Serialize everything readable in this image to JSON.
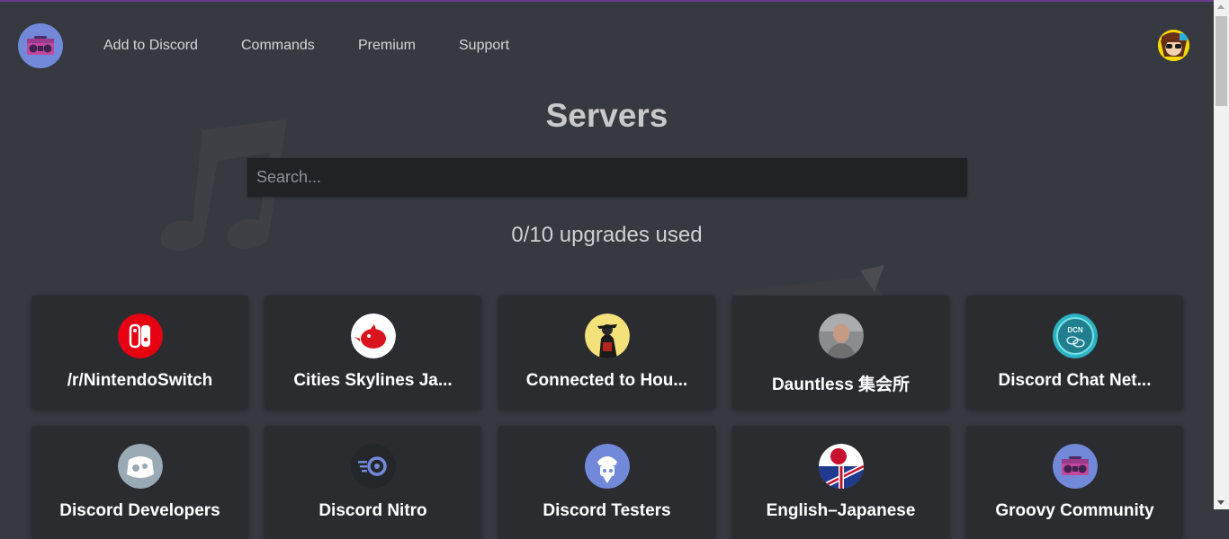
{
  "nav": {
    "logo": "boombox-logo",
    "links": [
      "Add to Discord",
      "Commands",
      "Premium",
      "Support"
    ],
    "user_avatar": "user-avatar"
  },
  "page": {
    "title": "Servers",
    "search_placeholder": "Search...",
    "upgrades_text": "0/10 upgrades used"
  },
  "servers": [
    {
      "name": "/r/NintendoSwitch",
      "icon": "nintendo-switch-icon",
      "color": "#e60012"
    },
    {
      "name": "Cities Skylines Ja...",
      "icon": "red-bird-icon",
      "color": "#ffffff"
    },
    {
      "name": "Connected to Hou...",
      "icon": "samurai-icon",
      "color": "#f5e17a"
    },
    {
      "name": "Dauntless 集会所",
      "icon": "person-photo-icon",
      "color": "#8a8d90"
    },
    {
      "name": "Discord Chat Net...",
      "icon": "dcn-icon",
      "color": "#2bb3c0"
    },
    {
      "name": "Discord Developers",
      "icon": "discord-gears-icon",
      "color": "#99aab5"
    },
    {
      "name": "Discord Nitro",
      "icon": "nitro-icon",
      "color": "#23272a"
    },
    {
      "name": "Discord Testers",
      "icon": "discord-tester-icon",
      "color": "#7289da"
    },
    {
      "name": "English–Japanese",
      "icon": "uk-japan-flag-icon",
      "color": "#ffffff"
    },
    {
      "name": "Groovy Community",
      "icon": "boombox-icon",
      "color": "#7289da"
    }
  ]
}
